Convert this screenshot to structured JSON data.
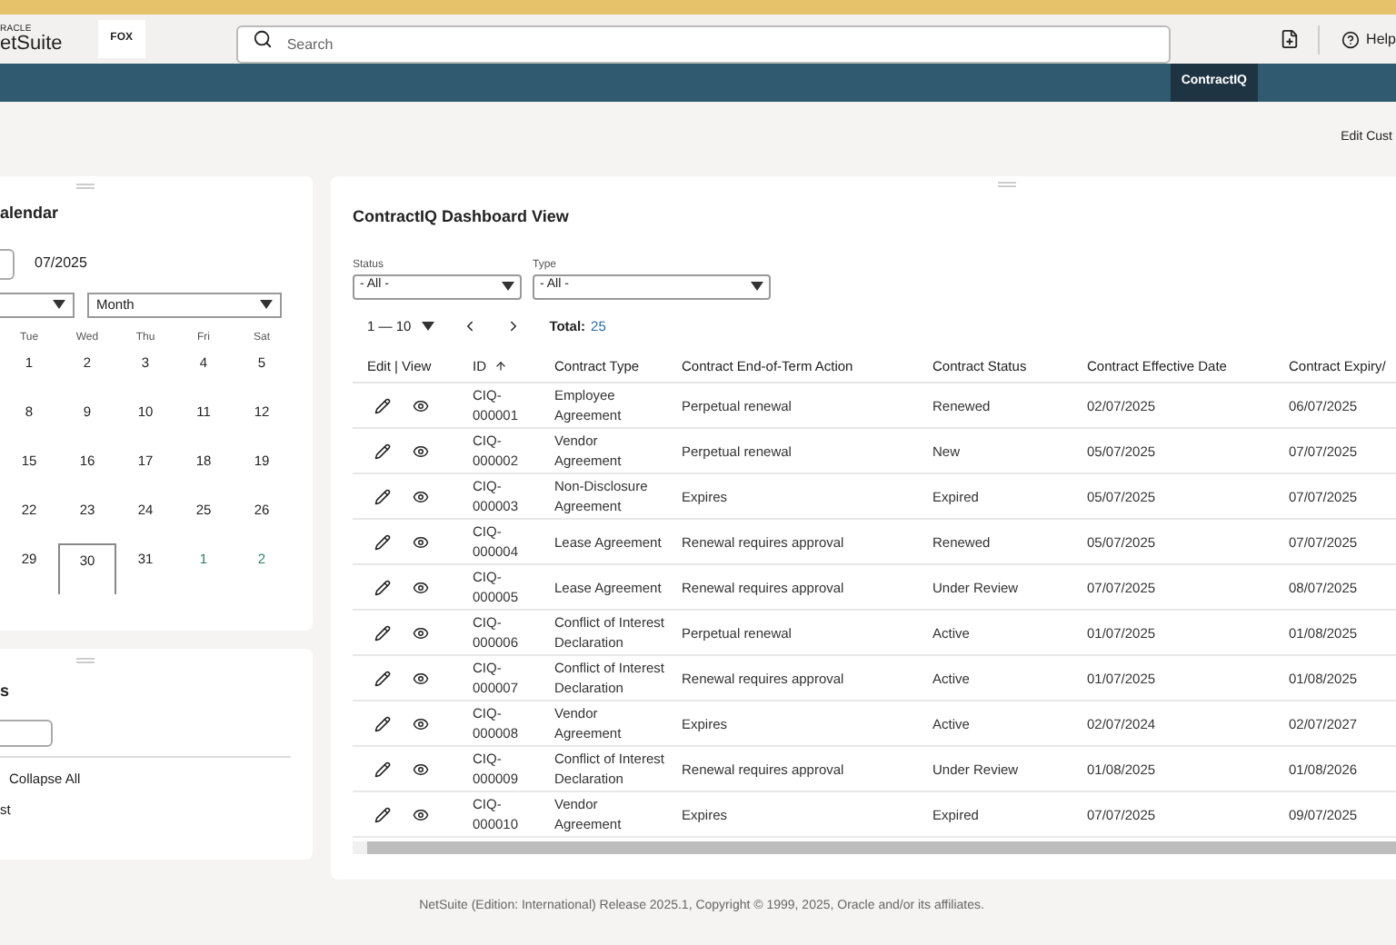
{
  "header": {
    "logo_top": "RACLE",
    "logo_bottom": "etSuite",
    "company_logo": "FOX",
    "search": {
      "placeholder": "Search"
    },
    "help": "Help"
  },
  "nav": {
    "tabs": [
      {
        "label": "ContractIQ",
        "selected": true
      }
    ]
  },
  "edit_link": "Edit Cust",
  "calendar_panel": {
    "title": "alendar",
    "period": "07/2025",
    "view_select": "Month",
    "weekdays": [
      "Tue",
      "Wed",
      "Thu",
      "Fri",
      "Sat"
    ],
    "weeks": [
      [
        {
          "day": "1",
          "other_month": false,
          "selected": false
        },
        {
          "day": "2",
          "other_month": false,
          "selected": false
        },
        {
          "day": "3",
          "other_month": false,
          "selected": false
        },
        {
          "day": "4",
          "other_month": false,
          "selected": false
        },
        {
          "day": "5",
          "other_month": false,
          "selected": false
        }
      ],
      [
        {
          "day": "8",
          "other_month": false,
          "selected": false
        },
        {
          "day": "9",
          "other_month": false,
          "selected": false
        },
        {
          "day": "10",
          "other_month": false,
          "selected": false
        },
        {
          "day": "11",
          "other_month": false,
          "selected": false
        },
        {
          "day": "12",
          "other_month": false,
          "selected": false
        }
      ],
      [
        {
          "day": "15",
          "other_month": false,
          "selected": false
        },
        {
          "day": "16",
          "other_month": false,
          "selected": false
        },
        {
          "day": "17",
          "other_month": false,
          "selected": false
        },
        {
          "day": "18",
          "other_month": false,
          "selected": false
        },
        {
          "day": "19",
          "other_month": false,
          "selected": false
        }
      ],
      [
        {
          "day": "22",
          "other_month": false,
          "selected": false
        },
        {
          "day": "23",
          "other_month": false,
          "selected": false
        },
        {
          "day": "24",
          "other_month": false,
          "selected": false
        },
        {
          "day": "25",
          "other_month": false,
          "selected": false
        },
        {
          "day": "26",
          "other_month": false,
          "selected": false
        }
      ],
      [
        {
          "day": "29",
          "other_month": false,
          "selected": false
        },
        {
          "day": "30",
          "other_month": false,
          "selected": true
        },
        {
          "day": "31",
          "other_month": false,
          "selected": false
        },
        {
          "day": "1",
          "other_month": true,
          "selected": false
        },
        {
          "day": "2",
          "other_month": true,
          "selected": false
        }
      ]
    ]
  },
  "second_panel": {
    "title": "s",
    "collapse_all": "Collapse All",
    "list_item": "st"
  },
  "dashboard": {
    "title": "ContractIQ Dashboard View",
    "filters": [
      {
        "label": "Status",
        "value": "- All -"
      },
      {
        "label": "Type",
        "value": "- All -"
      }
    ],
    "pager": {
      "range": "1 — 10",
      "total_label": "Total:",
      "total": "25"
    },
    "columns": [
      "Edit | View",
      "ID",
      "Contract Type",
      "Contract End-of-Term Action",
      "Contract Status",
      "Contract Effective Date",
      "Contract Expiry/"
    ],
    "rows": [
      {
        "id": "CIQ-000001",
        "type": "Employee Agreement",
        "action": "Perpetual renewal",
        "status": "Renewed",
        "effective": "02/07/2025",
        "expiry": "06/07/2025"
      },
      {
        "id": "CIQ-000002",
        "type": "Vendor Agreement",
        "action": "Perpetual renewal",
        "status": "New",
        "effective": "05/07/2025",
        "expiry": "07/07/2025"
      },
      {
        "id": "CIQ-000003",
        "type": "Non-Disclosure Agreement",
        "action": "Expires",
        "status": "Expired",
        "effective": "05/07/2025",
        "expiry": "07/07/2025"
      },
      {
        "id": "CIQ-000004",
        "type": "Lease Agreement",
        "action": "Renewal requires approval",
        "status": "Renewed",
        "effective": "05/07/2025",
        "expiry": "07/07/2025"
      },
      {
        "id": "CIQ-000005",
        "type": "Lease Agreement",
        "action": "Renewal requires approval",
        "status": "Under Review",
        "effective": "07/07/2025",
        "expiry": "08/07/2025"
      },
      {
        "id": "CIQ-000006",
        "type": "Conflict of Interest Declaration",
        "action": "Perpetual renewal",
        "status": "Active",
        "effective": "01/07/2025",
        "expiry": "01/08/2025"
      },
      {
        "id": "CIQ-000007",
        "type": "Conflict of Interest Declaration",
        "action": "Renewal requires approval",
        "status": "Active",
        "effective": "01/07/2025",
        "expiry": "01/08/2025"
      },
      {
        "id": "CIQ-000008",
        "type": "Vendor Agreement",
        "action": "Expires",
        "status": "Active",
        "effective": "02/07/2024",
        "expiry": "02/07/2027"
      },
      {
        "id": "CIQ-000009",
        "type": "Conflict of Interest Declaration",
        "action": "Renewal requires approval",
        "status": "Under Review",
        "effective": "01/08/2025",
        "expiry": "01/08/2026"
      },
      {
        "id": "CIQ-000010",
        "type": "Vendor Agreement",
        "action": "Expires",
        "status": "Expired",
        "effective": "07/07/2025",
        "expiry": "09/07/2025"
      }
    ]
  },
  "footer": "NetSuite (Edition: International) Release 2025.1, Copyright © 1999, 2025, Oracle and/or its affiliates."
}
